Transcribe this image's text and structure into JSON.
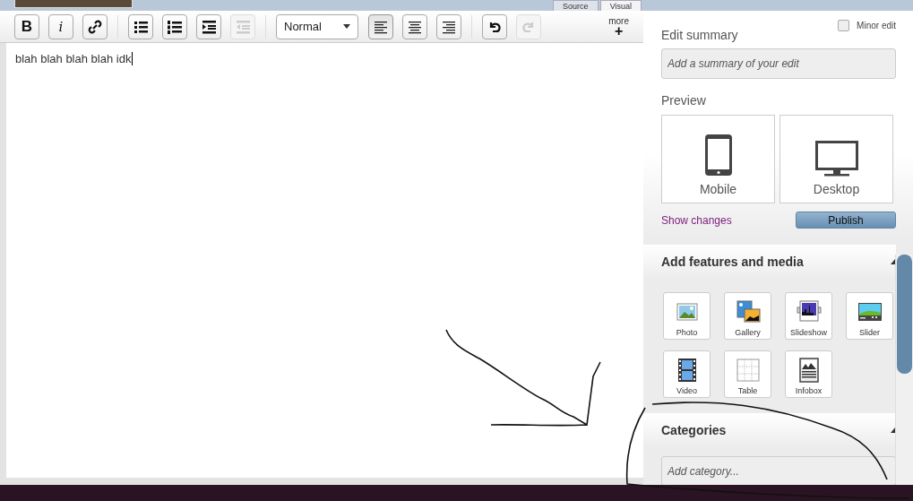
{
  "header": {
    "tabs": [
      {
        "label": "Source",
        "selected": false
      },
      {
        "label": "Visual",
        "selected": true
      }
    ]
  },
  "toolbar": {
    "items": [
      {
        "kind": "bold",
        "label": "B",
        "disabled": false,
        "selected": false
      },
      {
        "kind": "italic",
        "label": "i",
        "disabled": false,
        "selected": false
      },
      {
        "kind": "link",
        "disabled": false,
        "selected": false
      },
      {
        "kind": "separator"
      },
      {
        "kind": "bullets",
        "disabled": false,
        "selected": false
      },
      {
        "kind": "numbered",
        "disabled": false,
        "selected": false
      },
      {
        "kind": "indent",
        "disabled": false,
        "selected": false
      },
      {
        "kind": "outdent",
        "disabled": true,
        "selected": false
      },
      {
        "kind": "separator"
      },
      {
        "kind": "dropdown",
        "value": "Normal"
      },
      {
        "kind": "align-left",
        "disabled": false,
        "selected": true
      },
      {
        "kind": "align-center",
        "disabled": false,
        "selected": false
      },
      {
        "kind": "align-right",
        "disabled": false,
        "selected": false
      },
      {
        "kind": "separator"
      },
      {
        "kind": "undo",
        "disabled": false,
        "selected": false
      },
      {
        "kind": "redo",
        "disabled": true,
        "selected": false
      }
    ],
    "more": {
      "label": "more",
      "symbol": "+"
    }
  },
  "editor": {
    "text": "blah blah blah blah idk"
  },
  "sidebar": {
    "edit_summary": {
      "label": "Edit summary",
      "placeholder": "Add a summary of your edit"
    },
    "minor_edit": {
      "label": "Minor edit",
      "checked": false
    },
    "preview": {
      "label": "Preview",
      "buttons": [
        {
          "kind": "mobile",
          "label": "Mobile"
        },
        {
          "kind": "desktop",
          "label": "Desktop"
        }
      ]
    },
    "show_changes": "Show changes",
    "publish": "Publish",
    "sections": [
      {
        "kind": "features",
        "title": "Add features and media",
        "expanded": true,
        "items": [
          {
            "kind": "photo",
            "label": "Photo"
          },
          {
            "kind": "gallery",
            "label": "Gallery"
          },
          {
            "kind": "slideshow",
            "label": "Slideshow"
          },
          {
            "kind": "slider",
            "label": "Slider"
          },
          {
            "kind": "video",
            "label": "Video"
          },
          {
            "kind": "table",
            "label": "Table"
          },
          {
            "kind": "infobox",
            "label": "Infobox"
          }
        ]
      },
      {
        "kind": "categories",
        "title": "Categories",
        "expanded": true,
        "placeholder": "Add category..."
      }
    ]
  }
}
